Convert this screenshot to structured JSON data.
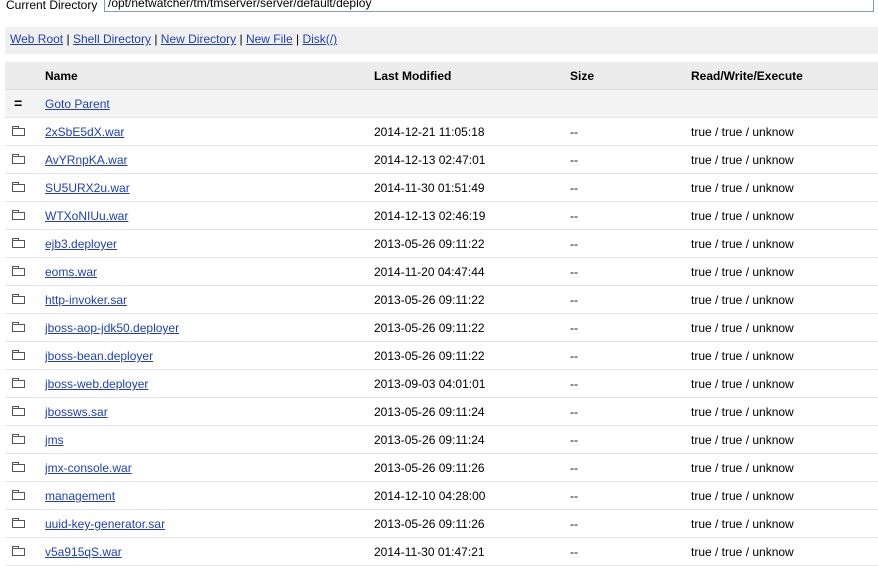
{
  "current_directory": {
    "label": "Current Directory",
    "value": "/opt/netwatcher/tm/tmserver/server/default/deploy"
  },
  "links": [
    {
      "label": "Web Root"
    },
    {
      "label": "Shell Directory"
    },
    {
      "label": "New Directory"
    },
    {
      "label": "New File"
    },
    {
      "label": "Disk(/)"
    }
  ],
  "separator": "|",
  "table": {
    "headers": {
      "name": "Name",
      "modified": "Last Modified",
      "size": "Size",
      "rwx": "Read/Write/Execute"
    },
    "parent": {
      "icon": "=",
      "label": "Goto Parent"
    },
    "rows": [
      {
        "name": "2xSbE5dX.war",
        "modified": "2014-12-21 11:05:18",
        "size": "--",
        "rwx": "true / true / unknow"
      },
      {
        "name": "AvYRnpKA.war",
        "modified": "2014-12-13 02:47:01",
        "size": "--",
        "rwx": "true / true / unknow"
      },
      {
        "name": "SU5URX2u.war",
        "modified": "2014-11-30 01:51:49",
        "size": "--",
        "rwx": "true / true / unknow"
      },
      {
        "name": "WTXoNIUu.war",
        "modified": "2014-12-13 02:46:19",
        "size": "--",
        "rwx": "true / true / unknow"
      },
      {
        "name": "ejb3.deployer",
        "modified": "2013-05-26 09:11:22",
        "size": "--",
        "rwx": "true / true / unknow"
      },
      {
        "name": "eoms.war",
        "modified": "2014-11-20 04:47:44",
        "size": "--",
        "rwx": "true / true / unknow"
      },
      {
        "name": "http-invoker.sar",
        "modified": "2013-05-26 09:11:22",
        "size": "--",
        "rwx": "true / true / unknow"
      },
      {
        "name": "jboss-aop-jdk50.deployer",
        "modified": "2013-05-26 09:11:22",
        "size": "--",
        "rwx": "true / true / unknow"
      },
      {
        "name": "jboss-bean.deployer",
        "modified": "2013-05-26 09:11:22",
        "size": "--",
        "rwx": "true / true / unknow"
      },
      {
        "name": "jboss-web.deployer",
        "modified": "2013-09-03 04:01:01",
        "size": "--",
        "rwx": "true / true / unknow"
      },
      {
        "name": "jbossws.sar",
        "modified": "2013-05-26 09:11:24",
        "size": "--",
        "rwx": "true / true / unknow"
      },
      {
        "name": "jms",
        "modified": "2013-05-26 09:11:24",
        "size": "--",
        "rwx": "true / true / unknow"
      },
      {
        "name": "jmx-console.war",
        "modified": "2013-05-26 09:11:26",
        "size": "--",
        "rwx": "true / true / unknow"
      },
      {
        "name": "management",
        "modified": "2014-12-10 04:28:00",
        "size": "--",
        "rwx": "true / true / unknow"
      },
      {
        "name": "uuid-key-generator.sar",
        "modified": "2013-05-26 09:11:26",
        "size": "--",
        "rwx": "true / true / unknow"
      },
      {
        "name": "v5a915qS.war",
        "modified": "2014-11-30 01:47:21",
        "size": "--",
        "rwx": "true / true / unknow"
      }
    ]
  },
  "icons": {
    "row_icon": "folder-icon",
    "parent_icon": "goto-parent-icon"
  },
  "colors": {
    "link": "#1f3fbf",
    "linkbar_bg": "#f0f0f0",
    "header_bg": "#ececec"
  }
}
